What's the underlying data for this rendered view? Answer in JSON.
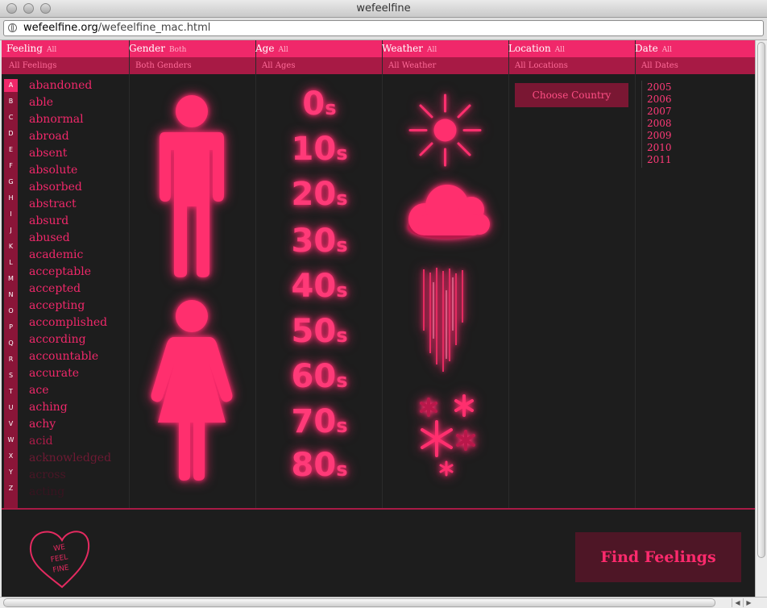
{
  "window": {
    "title": "wefeelfine"
  },
  "address": {
    "domain": "wefeelfine.org",
    "path": "/wefeelfine_mac.html"
  },
  "header": [
    {
      "label": "Feeling",
      "value": "All",
      "sub": "All Feelings"
    },
    {
      "label": "Gender",
      "value": "Both",
      "sub": "Both Genders"
    },
    {
      "label": "Age",
      "value": "All",
      "sub": "All Ages"
    },
    {
      "label": "Weather",
      "value": "All",
      "sub": "All Weather"
    },
    {
      "label": "Location",
      "value": "All",
      "sub": "All Locations"
    },
    {
      "label": "Date",
      "value": "All",
      "sub": "All Dates"
    }
  ],
  "letters": [
    "A",
    "B",
    "C",
    "D",
    "E",
    "F",
    "G",
    "H",
    "I",
    "J",
    "K",
    "L",
    "M",
    "N",
    "O",
    "P",
    "Q",
    "R",
    "S",
    "T",
    "U",
    "V",
    "W",
    "X",
    "Y",
    "Z"
  ],
  "selected_letter": "A",
  "feelings": [
    "abandoned",
    "able",
    "abnormal",
    "abroad",
    "absent",
    "absolute",
    "absorbed",
    "abstract",
    "absurd",
    "abused",
    "academic",
    "acceptable",
    "accepted",
    "accepting",
    "accomplished",
    "according",
    "accountable",
    "accurate",
    "ace",
    "aching",
    "achy",
    "acid",
    "acknowledged",
    "across",
    "acting"
  ],
  "ages": [
    {
      "num": "0",
      "suffix": "s"
    },
    {
      "num": "10",
      "suffix": "s"
    },
    {
      "num": "20",
      "suffix": "s"
    },
    {
      "num": "30",
      "suffix": "s"
    },
    {
      "num": "40",
      "suffix": "s"
    },
    {
      "num": "50",
      "suffix": "s"
    },
    {
      "num": "60",
      "suffix": "s"
    },
    {
      "num": "70",
      "suffix": "s"
    },
    {
      "num": "80",
      "suffix": "s"
    }
  ],
  "genders": [
    "male-icon",
    "female-icon"
  ],
  "weather": [
    "sun-icon",
    "cloud-icon",
    "rain-icon",
    "snow-icon"
  ],
  "location": {
    "choose_label": "Choose Country"
  },
  "dates": [
    "2005",
    "2006",
    "2007",
    "2008",
    "2009",
    "2010",
    "2011"
  ],
  "actions": {
    "find_label": "Find Feelings"
  },
  "logo_text": [
    "WE",
    "FEEL",
    "FINE"
  ],
  "colors": {
    "accent": "#f0286a",
    "accent_dark": "#a81a45",
    "background": "#1d1d1d",
    "button": "#4e1626"
  }
}
